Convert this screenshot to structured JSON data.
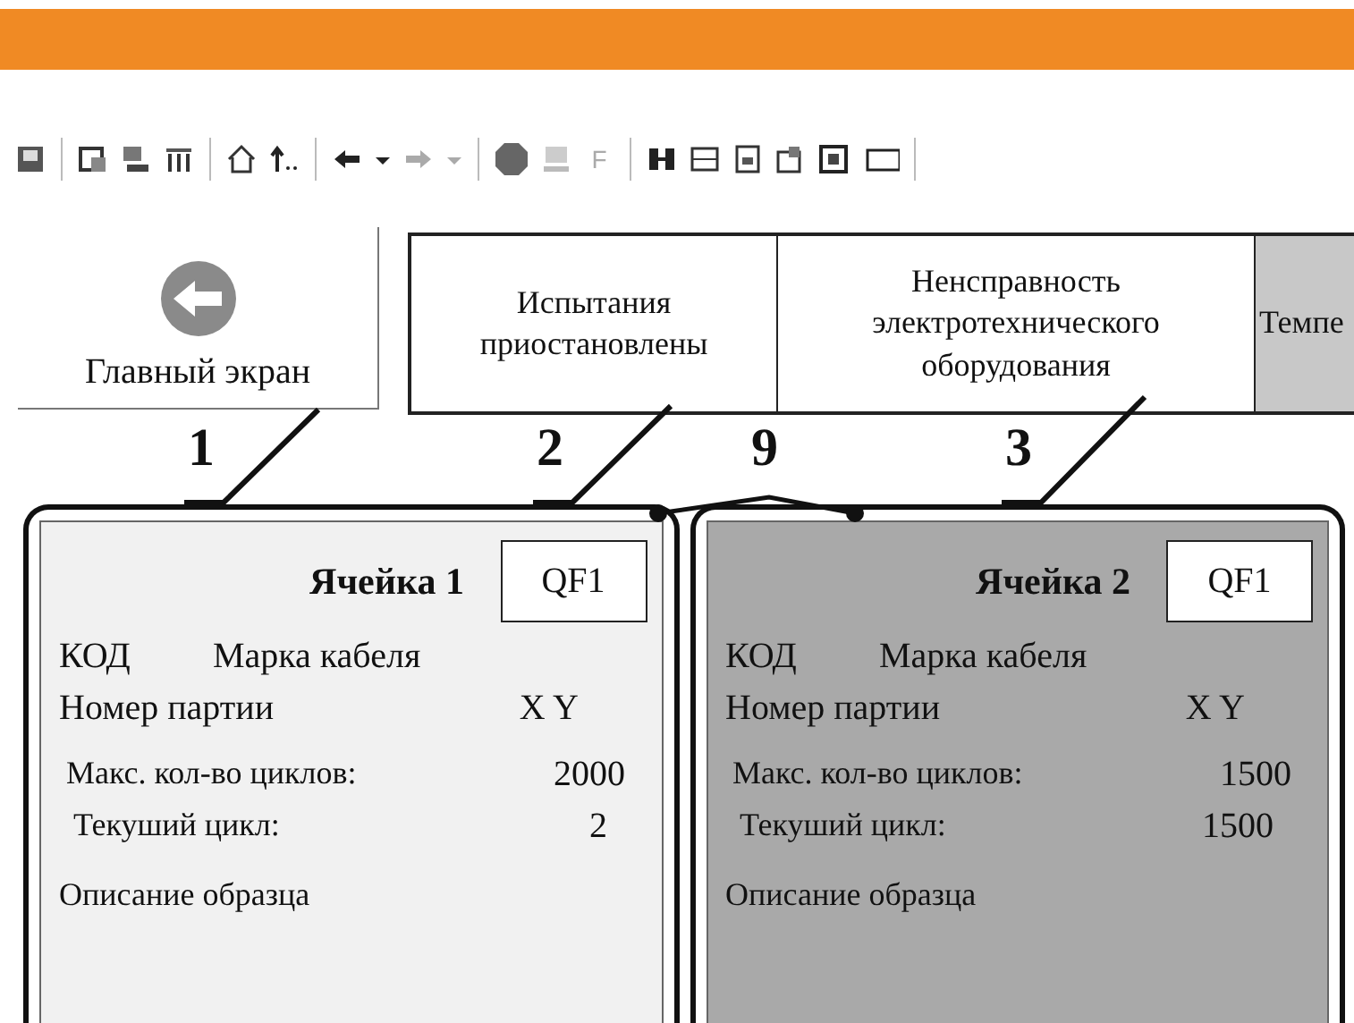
{
  "toolbar": {
    "letter_button": "F"
  },
  "main_button": {
    "label": "Главный экран"
  },
  "status_panels": [
    {
      "label": "Испытания приостановлены",
      "highlighted": false
    },
    {
      "label": "Ненсправность электротехнического оборудования",
      "highlighted": false
    },
    {
      "label": "Темпе",
      "highlighted": true
    }
  ],
  "callouts": [
    "1",
    "2",
    "9",
    "3"
  ],
  "cells": [
    {
      "title": "Ячейка 1",
      "breaker": "QF1",
      "highlighted": false,
      "code_label": "КОД",
      "cable_label": "Марка кабеля",
      "batch_label": "Номер партии",
      "batch_value": "X Y",
      "max_cycles_label": "Макс. кол-во циклов:",
      "max_cycles": "2000",
      "current_cycle_label": "Текуший цикл:",
      "current_cycle": "2",
      "description": "Описание образца"
    },
    {
      "title": "Ячейка 2",
      "breaker": "QF1",
      "highlighted": true,
      "code_label": "КОД",
      "cable_label": "Марка кабеля",
      "batch_label": "Номер партии",
      "batch_value": "X Y",
      "max_cycles_label": "Макс. кол-во циклов:",
      "max_cycles": "1500",
      "current_cycle_label": "Текуший цикл:",
      "current_cycle": "1500",
      "description": "Описание образца"
    }
  ]
}
